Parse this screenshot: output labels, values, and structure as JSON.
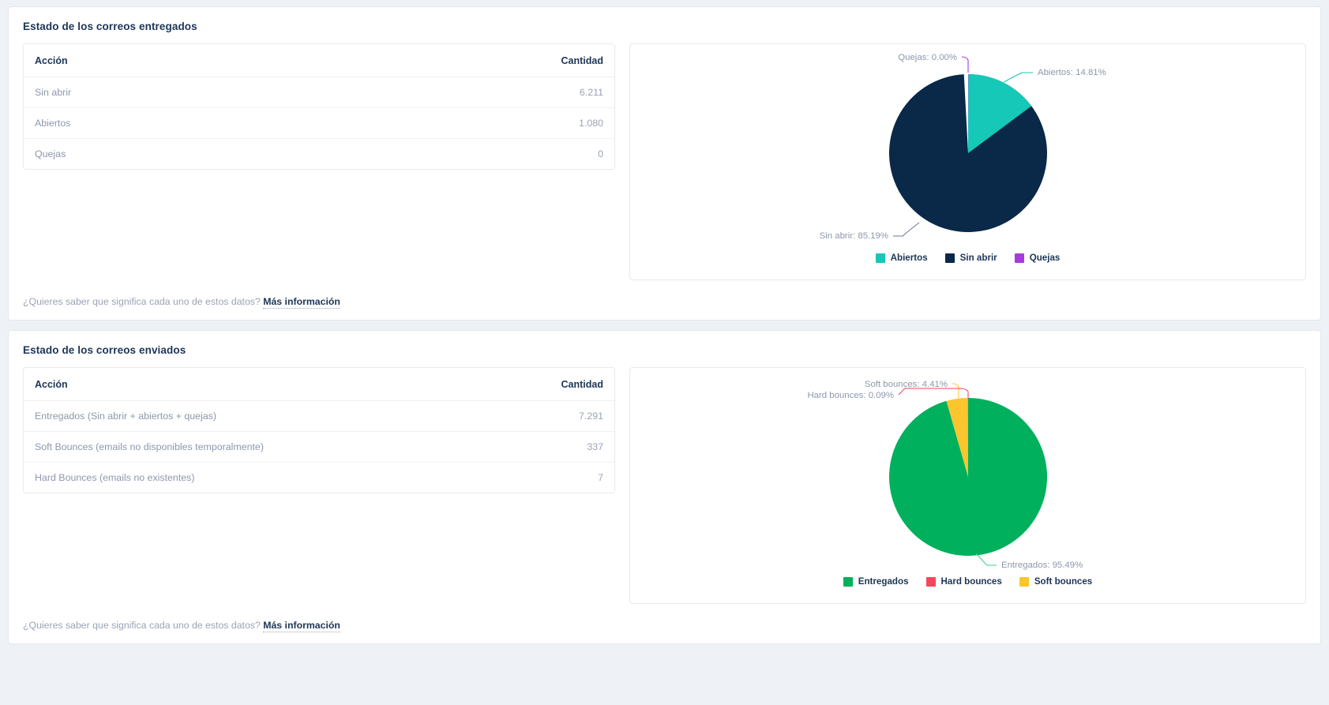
{
  "sections": [
    {
      "title": "Estado de los correos entregados",
      "table": {
        "columns": [
          "Acción",
          "Cantidad"
        ],
        "rows": [
          {
            "action": "Sin abrir",
            "amount": "6.211"
          },
          {
            "action": "Abiertos",
            "amount": "1.080"
          },
          {
            "action": "Quejas",
            "amount": "0"
          }
        ]
      },
      "footer": {
        "text": "¿Quieres saber que significa cada uno de estos datos?",
        "link": "Más información"
      },
      "legend": [
        {
          "label": "Abiertos",
          "color": "#16c8b7"
        },
        {
          "label": "Sin abrir",
          "color": "#0a2847"
        },
        {
          "label": "Quejas",
          "color": "#a83ae0"
        }
      ],
      "labels": [
        {
          "text": "Quejas: 0.00%",
          "color": "#a83ae0"
        },
        {
          "text": "Abiertos: 14.81%",
          "color": "#16c8b7"
        },
        {
          "text": "Sin abrir: 85.19%",
          "color": "#0a2847"
        }
      ]
    },
    {
      "title": "Estado de los correos enviados",
      "table": {
        "columns": [
          "Acción",
          "Cantidad"
        ],
        "rows": [
          {
            "action": "Entregados (Sin abrir + abiertos + quejas)",
            "amount": "7.291"
          },
          {
            "action": "Soft Bounces (emails no disponibles temporalmente)",
            "amount": "337"
          },
          {
            "action": "Hard Bounces (emails no existentes)",
            "amount": "7"
          }
        ]
      },
      "footer": {
        "text": "¿Quieres saber que significa cada uno de estos datos?",
        "link": "Más información"
      },
      "legend": [
        {
          "label": "Entregados",
          "color": "#00b05c"
        },
        {
          "label": "Hard bounces",
          "color": "#f5465d"
        },
        {
          "label": "Soft bounces",
          "color": "#fbc52d"
        }
      ],
      "labels": [
        {
          "text": "Soft bounces: 4.41%",
          "color": "#fbc52d"
        },
        {
          "text": "Hard bounces: 0.09%",
          "color": "#f5465d"
        },
        {
          "text": "Entregados: 95.49%",
          "color": "#00b05c"
        }
      ]
    }
  ],
  "chart_data": [
    {
      "type": "pie",
      "title": "Estado de los correos entregados",
      "labels": [
        "Abiertos",
        "Sin abrir",
        "Quejas"
      ],
      "values": [
        1080,
        6211,
        0
      ],
      "percentages": [
        14.81,
        85.19,
        0.0
      ],
      "colors": [
        "#16c8b7",
        "#0a2847",
        "#a83ae0"
      ],
      "legend_position": "bottom",
      "annotations": [
        "Quejas: 0.00%",
        "Abiertos: 14.81%",
        "Sin abrir: 85.19%"
      ]
    },
    {
      "type": "pie",
      "title": "Estado de los correos enviados",
      "labels": [
        "Entregados",
        "Soft bounces",
        "Hard bounces"
      ],
      "values": [
        7291,
        337,
        7
      ],
      "percentages": [
        95.49,
        4.41,
        0.09
      ],
      "colors": [
        "#00b05c",
        "#fbc52d",
        "#f5465d"
      ],
      "legend_position": "bottom",
      "annotations": [
        "Soft bounces: 4.41%",
        "Hard bounces: 0.09%",
        "Entregados: 95.49%"
      ]
    }
  ]
}
